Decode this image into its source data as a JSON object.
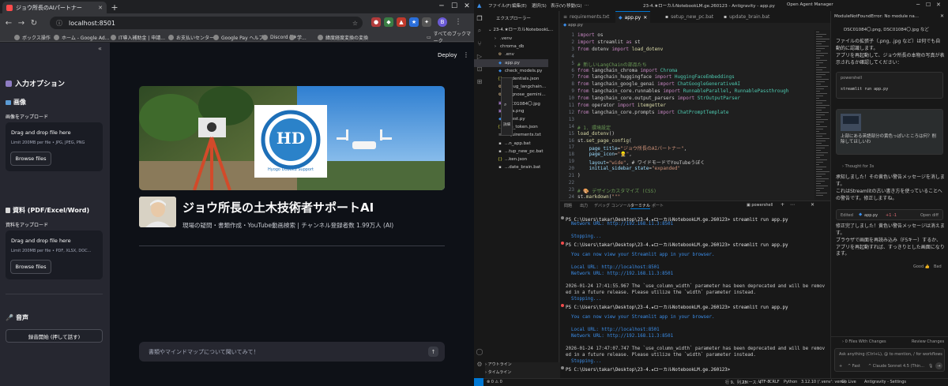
{
  "browser": {
    "tab_title": "ジョウ所長のAIパートナー",
    "url": "localhost:8501",
    "bookmarks": [
      "ボックス操作",
      "ホーム - Google Ad...",
      "IT導入補助金 | 申請...",
      "お支払いセンター",
      "Google Pay ヘルプ",
      "Discord | #",
      "学...",
      "緯度経度変換の変換"
    ],
    "bookmarks_all": "すべてのブックマーク",
    "profile_initial": "B"
  },
  "app": {
    "deploy": "Deploy",
    "sidebar_title": "入力オプション",
    "image_header": "画像",
    "image_label": "画像をアップロード",
    "image_drop": "Drag and drop file here",
    "image_limit": "Limit 200MB per file • JPG, JPEG, PNG",
    "browse": "Browse files",
    "doc_header": "資料 (PDF/Excel/Word)",
    "doc_label": "資料をアップロード",
    "doc_drop": "Drag and drop file here",
    "doc_limit": "Limit 200MB per file • PDF, XLSX, DOC...",
    "audio_header": "音声",
    "record_button": "録音開始 (押して話す)",
    "logo_text": "Hyogo Doboku Support",
    "logo_initials": "HD",
    "main_title": "ジョウ所長の土木技術者サポートAI",
    "main_caption": "現場の疑問・書類作成・YouTube動画検索 | チャンネル登録者数 1.99万人 (AI)",
    "chat_placeholder": "書類やマインドマップについて聞いてみて！"
  },
  "vscode": {
    "menus": [
      "ファイル(F)",
      "編集(E)",
      "選択(S)",
      "表示(V)",
      "移動(G)",
      "..."
    ],
    "window_title": "23-4.★ローカルNotebookLM.ge.260123 - Antigravity - app.py",
    "agent_manager": "Open Agent Manager",
    "explorer_title": "エクスプローラー",
    "project": "23-4.★ローカルNotebookL...",
    "files": [
      ".venv",
      "chroma_db",
      ".env",
      "app.py",
      "check_models.py",
      "credentials.json",
      "debug_langchain...",
      "diagnose_gemini...",
      "DSC01084〇.jpg",
      "fdda.png",
      "...gest.py",
      "...m_token.json",
      "...quirements.txt",
      "...n_app.bat",
      "...tup_new_pc.bat",
      "...ken.json",
      "...date_brain.bat"
    ],
    "ctx_label": "詳細",
    "tabs": [
      "requirements.txt",
      "app.py",
      "setup_new_pc.bat",
      "update_brain.bat"
    ],
    "breadcrumb": "app.py",
    "code_lines": [
      "import os",
      "import streamlit as st",
      "from dotenv import load_dotenv",
      "",
      "# 新しいLangChainの部品たち",
      "from langchain_chroma import Chroma",
      "from langchain_huggingface import HuggingFaceEmbeddings",
      "from langchain_google_genai import ChatGoogleGenerativeAI",
      "from langchain_core.runnables import RunnableParallel, RunnablePassthrough",
      "from langchain_core.output_parsers import StrOutputParser",
      "from operator import itemgetter",
      "from langchain_core.prompts import ChatPromptTemplate",
      "",
      "# 1. 環境設定",
      "load_dotenv()",
      "st.set_page_config(",
      "    page_title=\"ジョウ所長のAIパートナー\",",
      "    page_icon=\"👷\",",
      "    layout=\"wide\", # ワイドモードでYouTubeうぼく",
      "    initial_sidebar_state=\"expanded\"",
      ")",
      "",
      "# 🎨 デザインカスタマイズ (CSS)",
      "st.markdown(\"\"\""
    ],
    "line_numbers": [
      "1",
      "2",
      "3",
      "4",
      "5",
      "6",
      "7",
      "8",
      "9",
      "10",
      "11",
      "12",
      "13",
      "14",
      "15",
      "16",
      "17",
      "18",
      "19",
      "20",
      "21",
      "22",
      "23",
      "24"
    ],
    "panel_tabs": [
      "問題",
      "出力",
      "デバッグ コンソール",
      "ターミナル",
      "ポート"
    ],
    "terminal_shell": "powershell",
    "terminal_lines": [
      "PS C:\\Users\\takar\\Desktop\\23-4.★ローカルNotebookLM.ge.260123> streamlit run app.py",
      "  Network URL: http://192.168.11.3:8501",
      "",
      "  Stopping...",
      "PS C:\\Users\\takar\\Desktop\\23-4.★ローカルNotebookLM.ge.260123> streamlit run app.py",
      "",
      "  You can now view your Streamlit app in your browser.",
      "",
      "  Local URL: http://localhost:8501",
      "  Network URL: http://192.168.11.3:8501",
      "",
      "2026-01-24 17:41:55.967 The `use_column_width` parameter has been deprecated and will be remov",
      "ed in a future release. Please utilize the `width` parameter instead.",
      "  Stopping...",
      "PS C:\\Users\\takar\\Desktop\\23-4.★ローカルNotebookLM.ge.260123> streamlit run app.py",
      "",
      "  You can now view your Streamlit app in your browser.",
      "",
      "  Local URL: http://localhost:8501",
      "  Network URL: http://192.168.11.3:8501",
      "",
      "2026-01-24 17:47:07.747 The `use_column_width` parameter has been deprecated and will be remov",
      "ed in a future release. Please utilize the `width` parameter instead.",
      "  Stopping...",
      "PS C:\\Users\\takar\\Desktop\\23-4.★ローカルNotebookLM.ge.260123> "
    ],
    "outline": "アウトライン",
    "timeline": "タイムライン",
    "status": {
      "errors": "⊗ 0 ⚠ 0",
      "position": "行 9、列 75",
      "spaces": "スペース: 4",
      "encoding": "UTF-8",
      "eol": "CRLF",
      "language": "Python",
      "python": "3.12.10 ('.venv': venv)",
      "golive": "Go Live",
      "antigravity": "Antigravity - Settings"
    },
    "agent": {
      "title": "ModuleNotFoundError: No module na...",
      "file_chip": "DSC01084〇.png, DSC01084〇.jpg など",
      "msg1": "ファイルの拡張子（.png, .jpg など）は何でも自動的に認識します。",
      "msg2": "アプリを再起動して、ジョウ所長の本物の写真が表示されるか確認してください：",
      "shell_label": "powershell",
      "shell_cmd": "streamlit run app.py",
      "user_msg": "上部にある英語部分の黄色っぽいところは何？削除してほしいわ",
      "thought": "Thought for 3s",
      "reply1": "承知しました！その黄色い警告メッセージを消します。",
      "reply2": "これはStreamlitの古い書き方を使っていることへの警告です。修正しますね。",
      "edited": "Edited",
      "edited_file": "app.py",
      "diff": "+1 -1",
      "open_diff": "Open diff",
      "done1": "修正完了しました！黄色い警告メッセージは消えます。",
      "done2": "ブラウザで画面を再読み込み（F5キー）するか、アプリを再起動すれば、すっきりとした画面になります。",
      "good": "Good",
      "bad": "Bad",
      "files_changed": "0 Files With Changes",
      "review": "Review Changes",
      "input_placeholder": "Ask anything (Ctrl+L), @ to mention, / for workflows",
      "mode": "Fast",
      "model": "Claude Sonnet 4.5 (Thin..."
    }
  },
  "colors": {
    "accent": "#0078d4",
    "streamlit_red": "#ff4b4b",
    "keyword": "#c586c0",
    "comment": "#6a9955",
    "string": "#ce9178",
    "terminal_blue": "#3b8eea"
  }
}
